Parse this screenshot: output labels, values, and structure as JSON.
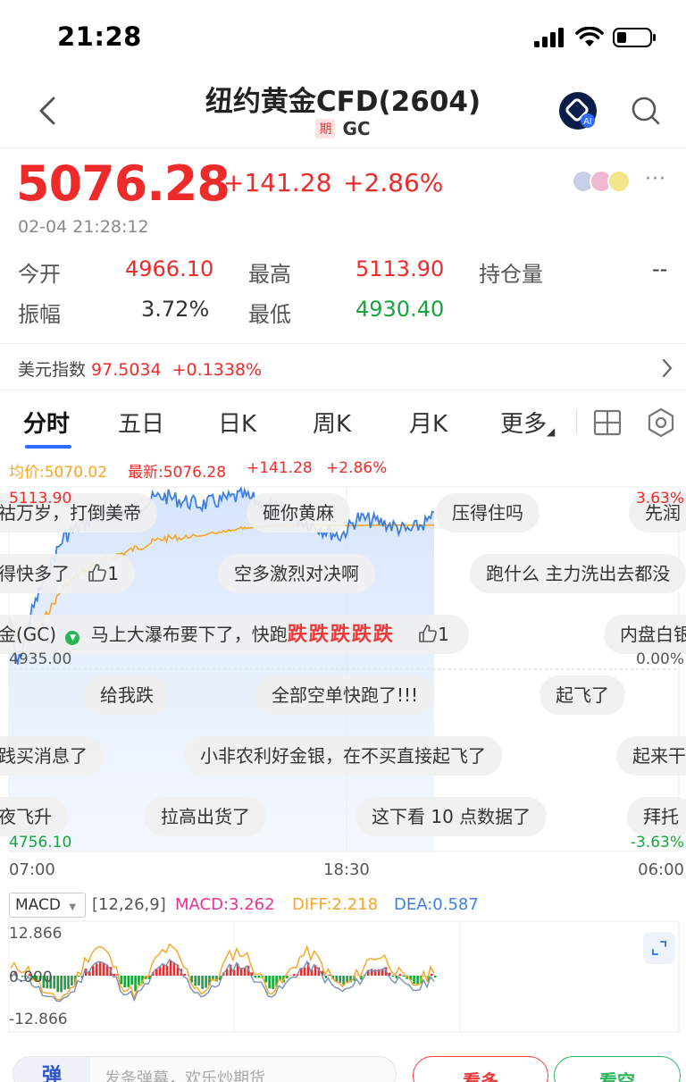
{
  "status_bar": {
    "time": "21:28"
  },
  "header": {
    "title": "纽约黄金CFD(2604)",
    "tag": "期",
    "code": "GC"
  },
  "quote": {
    "price": "5076.28",
    "change": "+141.28",
    "change_pct": "+2.86%",
    "timestamp": "02-04 21:28:12",
    "more": "···"
  },
  "stats": {
    "open_label": "今开",
    "open": "4966.10",
    "high_label": "最高",
    "high": "5113.90",
    "oi_label": "持仓量",
    "oi": "--",
    "amp_label": "振幅",
    "amp": "3.72%",
    "low_label": "最低",
    "low": "4930.40"
  },
  "usd_index": {
    "label": "美元指数",
    "value": "97.5034",
    "change": "+0.1338%"
  },
  "tabs": [
    {
      "label": "分时"
    },
    {
      "label": "五日"
    },
    {
      "label": "日K"
    },
    {
      "label": "周K"
    },
    {
      "label": "月K"
    },
    {
      "label": "更多"
    }
  ],
  "chart_info": {
    "avg": "均价:5070.02",
    "latest": "最新:5076.28",
    "chg": "+141.28",
    "pct": "+2.86%"
  },
  "chart_labels": {
    "y_top": "5113.90",
    "y_mid": "4935.00",
    "y_bottom": "4756.10",
    "pct_top": "3.63%",
    "pct_mid": "0.00%",
    "pct_bottom": "-3.63%",
    "x_start": "07:00",
    "x_mid": "18:30",
    "x_end": "06:00"
  },
  "comments": [
    {
      "text": "祜万岁，打倒美帝"
    },
    {
      "text": "砸你黄麻"
    },
    {
      "text": "压得住吗"
    },
    {
      "text": "先润"
    },
    {
      "text": "得快多了"
    },
    {
      "text": "1"
    },
    {
      "text": "空多激烈对决啊"
    },
    {
      "text": "跑什么 主力洗出去都没"
    },
    {
      "text": "金(GC)"
    },
    {
      "text": "马上大瀑布要下了，快跑"
    },
    {
      "text": "跌跌跌跌跌"
    },
    {
      "text": "1"
    },
    {
      "text": "内盘白银"
    },
    {
      "text": "给我跌"
    },
    {
      "text": "全部空单快跑了!!!"
    },
    {
      "text": "起飞了"
    },
    {
      "text": "践买消息了"
    },
    {
      "text": "小非农利好金银，在不买直接起飞了"
    },
    {
      "text": "起来干"
    },
    {
      "text": "夜飞升"
    },
    {
      "text": "拉高出货了"
    },
    {
      "text": "这下看 10 点数据了"
    },
    {
      "text": "拜托"
    }
  ],
  "macd": {
    "indicator": "MACD",
    "params": "[12,26,9]",
    "macd": "MACD:3.262",
    "diff": "DIFF:2.218",
    "dea": "DEA:0.587",
    "y_top": "12.866",
    "y_mid": "0.000",
    "y_bottom": "-12.866"
  },
  "bottom_bar": {
    "lead": "弹",
    "placeholder": "发条弹幕，欢乐炒期货",
    "long": "看多",
    "short": "看空"
  },
  "colors": {
    "up": "#ee2b2b",
    "down": "#18a43c",
    "price_line": "#3d7fe6",
    "avg_line": "#f5a623",
    "accent": "#2f6bff",
    "macd": "#e6339a",
    "diff": "#f5a623",
    "dea": "#3d7fe6"
  }
}
